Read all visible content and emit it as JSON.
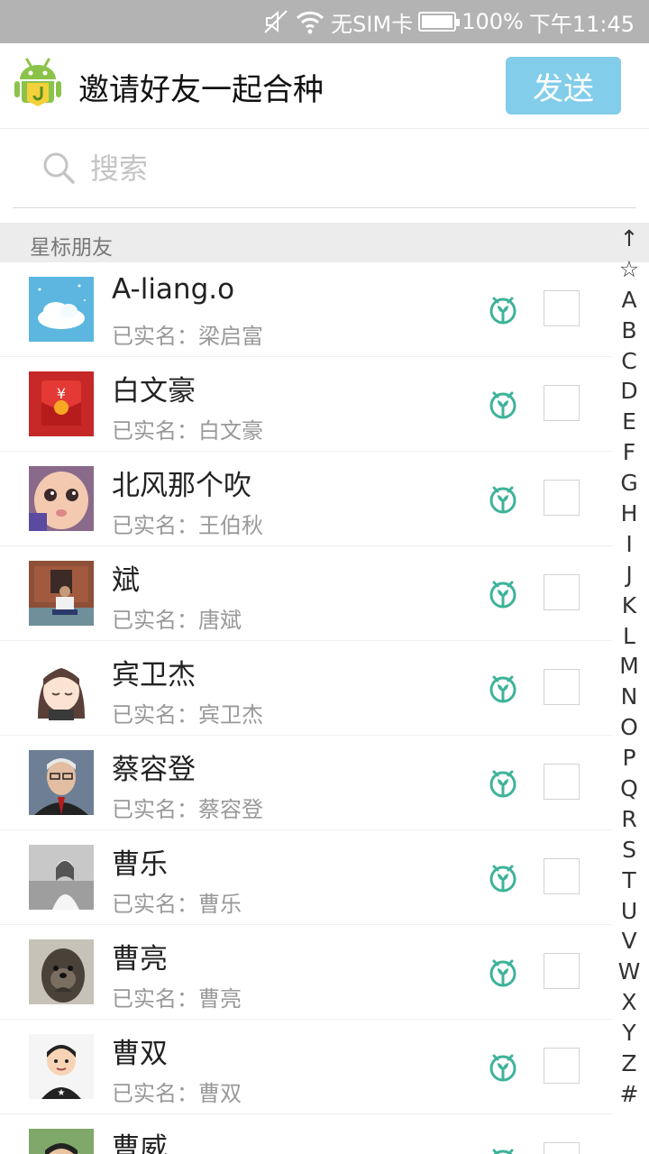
{
  "status_bar": {
    "carrier": "无SIM卡",
    "battery": "100%",
    "time": "下午11:45",
    "battery_level": 1.0
  },
  "header": {
    "app_icon": "android-j-icon",
    "title": "邀请好友一起合种",
    "send_label": "发送"
  },
  "search": {
    "placeholder": "搜索",
    "value": ""
  },
  "section": {
    "title": "星标朋友"
  },
  "contacts": [
    {
      "name": "A-liang.o",
      "realname": "已实名：梁启富",
      "avatar": "sky-clouds"
    },
    {
      "name": "白文豪",
      "realname": "已实名：白文豪",
      "avatar": "red-envelope"
    },
    {
      "name": "北风那个吹",
      "realname": "已实名：王伯秋",
      "avatar": "baby-face"
    },
    {
      "name": "斌",
      "realname": "已实名：唐斌",
      "avatar": "man-sitting-temple"
    },
    {
      "name": "宾卫杰",
      "realname": "已实名：宾卫杰",
      "avatar": "anime-girl"
    },
    {
      "name": "蔡容登",
      "realname": "已实名：蔡容登",
      "avatar": "elderly-man"
    },
    {
      "name": "曹乐",
      "realname": "已实名：曹乐",
      "avatar": "woman-bw"
    },
    {
      "name": "曹亮",
      "realname": "已实名：曹亮",
      "avatar": "otter"
    },
    {
      "name": "曹双",
      "realname": "已实名：曹双",
      "avatar": "cartoon-boy"
    },
    {
      "name": "曹威",
      "realname": "",
      "avatar": "young-man"
    }
  ],
  "index_letters": [
    "↑",
    "☆",
    "A",
    "B",
    "C",
    "D",
    "E",
    "F",
    "G",
    "H",
    "I",
    "J",
    "K",
    "L",
    "M",
    "N",
    "O",
    "P",
    "Q",
    "R",
    "S",
    "T",
    "U",
    "V",
    "W",
    "X",
    "Y",
    "Z",
    "#"
  ],
  "colors": {
    "accent": "#82cdea",
    "sprout": "#3fb39a",
    "status_bar": "#b3b3b3"
  }
}
